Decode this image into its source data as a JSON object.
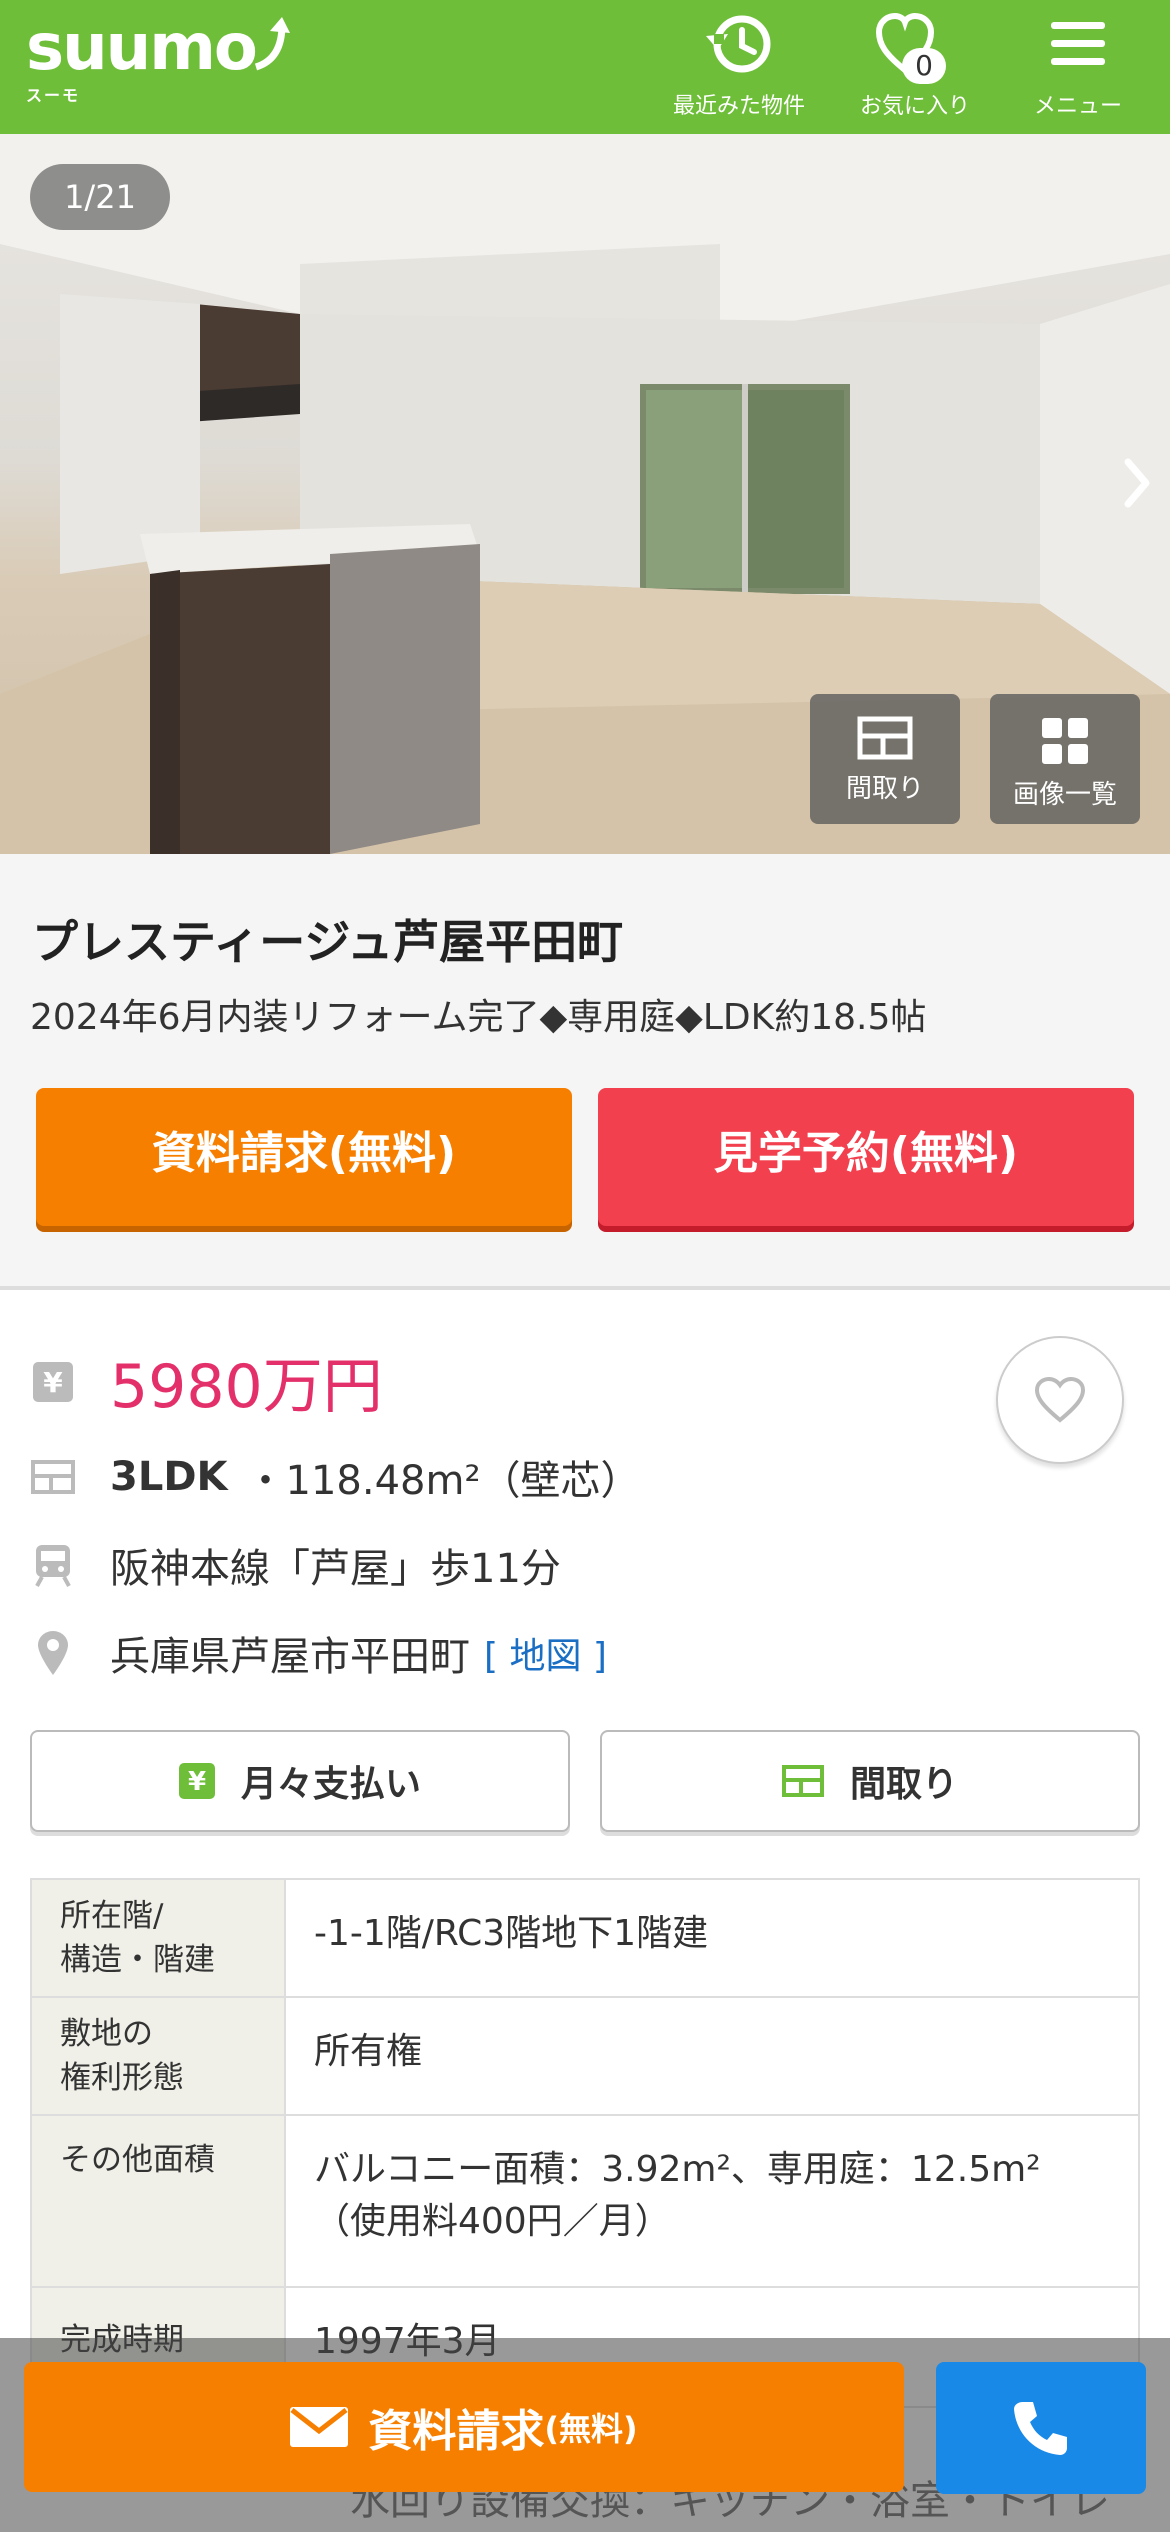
{
  "header": {
    "logo": "suumo",
    "logo_sub": "スーモ",
    "recent_label": "最近みた物件",
    "favorites_label": "お気に入り",
    "favorites_count": "0",
    "menu_label": "メニュー",
    "brand_color": "#6fbe3a"
  },
  "gallery": {
    "counter": "1/21",
    "floorplan_label": "間取り",
    "image_list_label": "画像一覧"
  },
  "property": {
    "name": "プレスティージュ芦屋平田町",
    "catch_copy": "2024年6月内装リフォーム完了◆専用庭◆LDK約18.5帖",
    "request_button": "資料請求(無料)",
    "visit_button": "見学予約(無料)"
  },
  "info": {
    "price": "5980万円",
    "layout": "3LDK",
    "area": "・118.48m²（壁芯）",
    "access": "阪神本線「芦屋」歩11分",
    "address": "兵庫県芦屋市平田町",
    "map_link": "[ 地図 ]",
    "monthly_button": "月々支払い",
    "floorplan_button": "間取り",
    "price_color": "#e4306a"
  },
  "spec": {
    "rows": [
      {
        "label_l1": "所在階/",
        "label_l2": "構造・階建",
        "value_l1": "-1-1階/RC3階地下1階建",
        "value_l2": ""
      },
      {
        "label_l1": "敷地の",
        "label_l2": "権利形態",
        "value_l1": "所有権",
        "value_l2": ""
      },
      {
        "label_l1": "その他面積",
        "label_l2": "",
        "value_l1": "バルコニー面積：3.92m²、専用庭：12.5m²",
        "value_l2": "（使用料400円／月）"
      },
      {
        "label_l1": "完成時期",
        "label_l2": "",
        "value_l1": "1997年3月",
        "value_l2": ""
      }
    ],
    "peek_text": "水回り設備交換：キッチン・浴室・トイレ"
  },
  "bottom_bar": {
    "request_main": "資料請求",
    "request_sub": "(無料)"
  }
}
